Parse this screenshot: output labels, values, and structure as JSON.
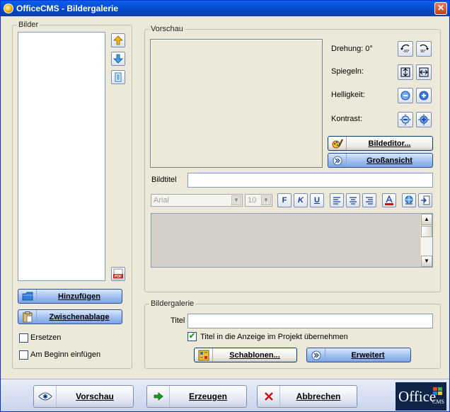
{
  "window": {
    "title": "OfficeCMS - Bildergalerie"
  },
  "bilder": {
    "legend": "Bilder",
    "add_button": "Hinzufügen",
    "clipboard_button": "Zwischenablage",
    "replace_label": "Ersetzen",
    "prepend_label": "Am Beginn einfügen",
    "icons": {
      "up": "arrow-up-icon",
      "down": "arrow-down-icon",
      "delete": "delete-icon",
      "pdf": "pdf-icon"
    }
  },
  "vorschau": {
    "legend": "Vorschau",
    "rotation_label": "Drehung: 0°",
    "mirror_label": "Spiegeln:",
    "brightness_label": "Helligkeit:",
    "contrast_label": "Kontrast:",
    "rotate_left_text": "-90°",
    "rotate_right_text": "90°",
    "image_editor_button": "Bildeditor...",
    "large_view_button": "Großansicht",
    "caption_label": "Bildtitel",
    "caption_value": "",
    "font_family": "Arial",
    "font_size": "10",
    "bold": "F",
    "italic": "K",
    "underline": "U"
  },
  "galerie": {
    "legend": "Bildergalerie",
    "title_label": "Titel",
    "title_value": "",
    "show_title_label": "Titel in die Anzeige im Projekt übernehmen",
    "show_title_checked": true,
    "templates_button": "Schablonen...",
    "advanced_button": "Erweitert"
  },
  "footer": {
    "preview_button": "Vorschau",
    "generate_button": "Erzeugen",
    "cancel_button": "Abbrechen",
    "logo_main": "Office",
    "logo_sub": "CMS"
  },
  "colors": {
    "accent": "#0a5fe8",
    "window_bg": "#ECE9D8",
    "cancel_red": "#d01010",
    "generate_green": "#1e9a1e"
  }
}
